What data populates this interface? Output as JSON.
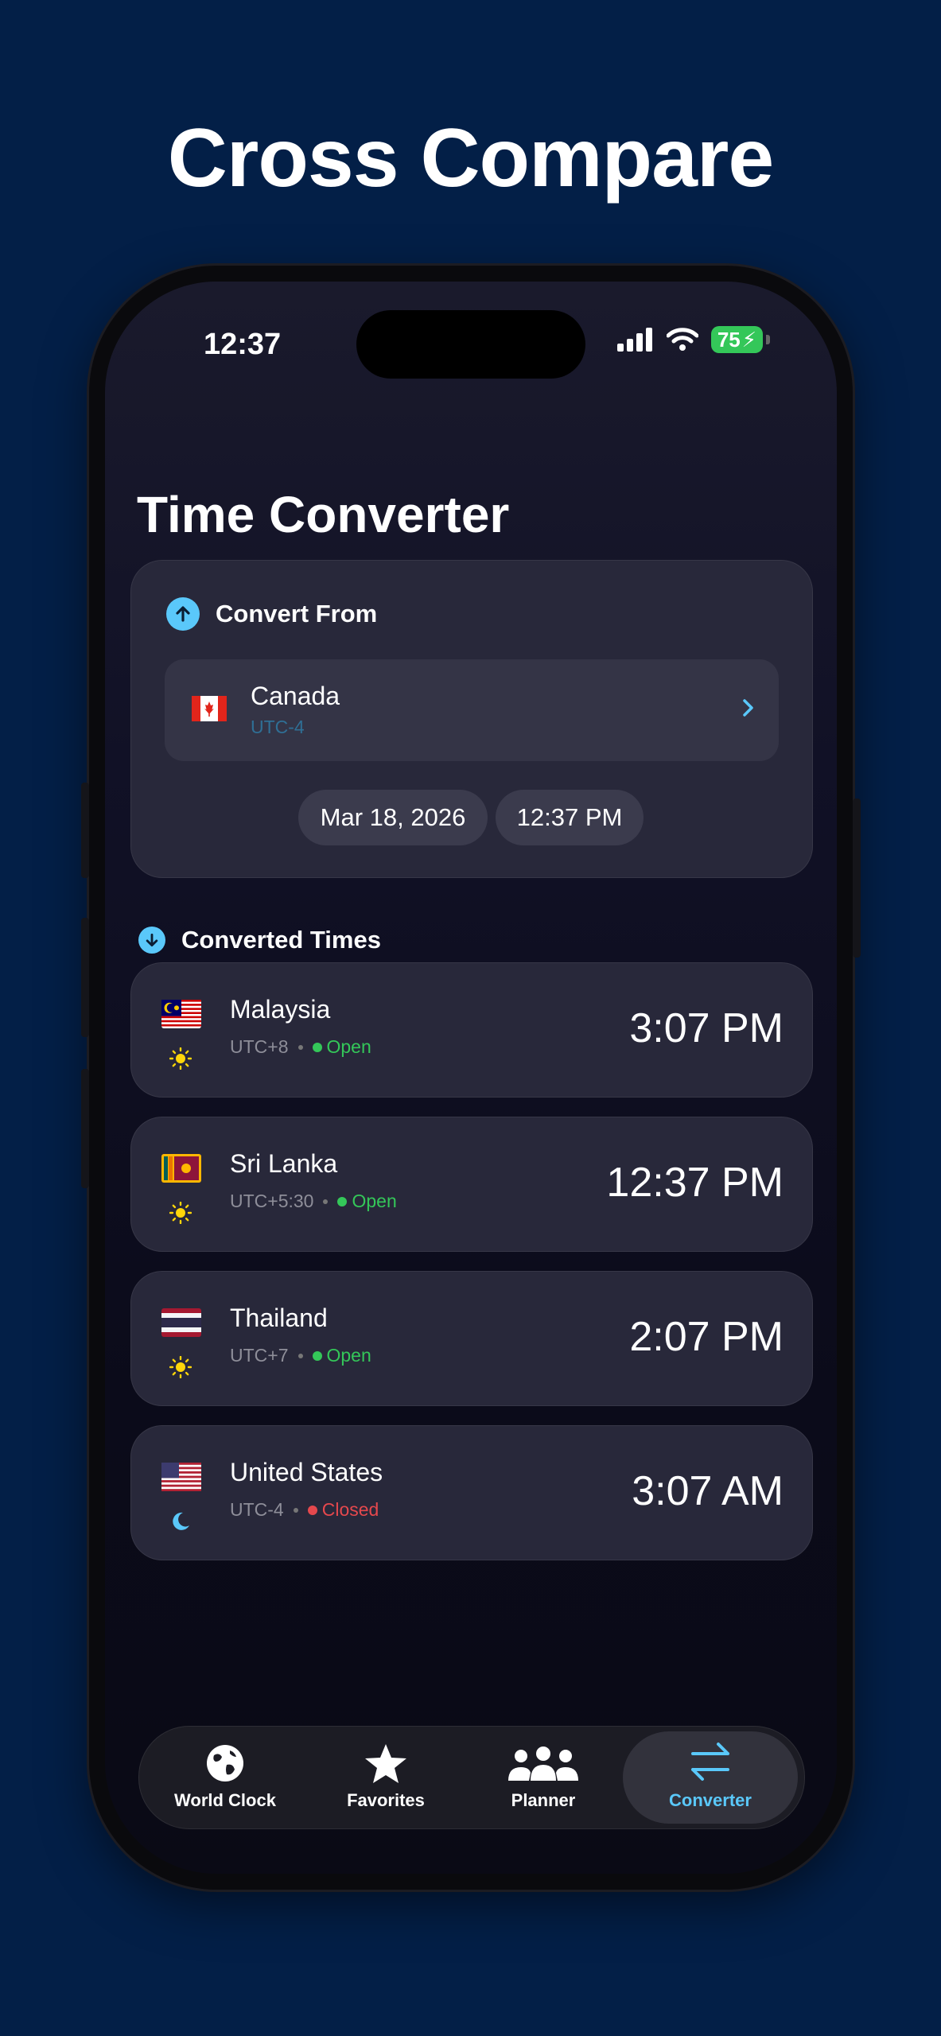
{
  "headline": "Cross Compare",
  "status_bar": {
    "time": "12:37",
    "battery": "75"
  },
  "page_title": "Time Converter",
  "convert_from": {
    "label": "Convert From",
    "country": "Canada",
    "utc": "UTC-4",
    "date": "Mar 18, 2026",
    "time": "12:37 PM"
  },
  "converted": {
    "label": "Converted Times",
    "items": [
      {
        "country": "Malaysia",
        "utc": "UTC+8",
        "status": "Open",
        "time": "3:07 PM",
        "period": "day"
      },
      {
        "country": "Sri Lanka",
        "utc": "UTC+5:30",
        "status": "Open",
        "time": "12:37 PM",
        "period": "day"
      },
      {
        "country": "Thailand",
        "utc": "UTC+7",
        "status": "Open",
        "time": "2:07 PM",
        "period": "day"
      },
      {
        "country": "United States",
        "utc": "UTC-4",
        "status": "Closed",
        "time": "3:07 AM",
        "period": "night"
      }
    ]
  },
  "tabs": [
    {
      "label": "World Clock",
      "icon": "globe-icon"
    },
    {
      "label": "Favorites",
      "icon": "star-icon"
    },
    {
      "label": "Planner",
      "icon": "people-icon"
    },
    {
      "label": "Converter",
      "icon": "arrows-icon",
      "active": true
    }
  ],
  "colors": {
    "background": "#031f47",
    "accent": "#5ac8fa",
    "open": "#34c759",
    "closed": "#e5484d",
    "sun": "#ffd60a",
    "moon": "#5ac8fa"
  }
}
